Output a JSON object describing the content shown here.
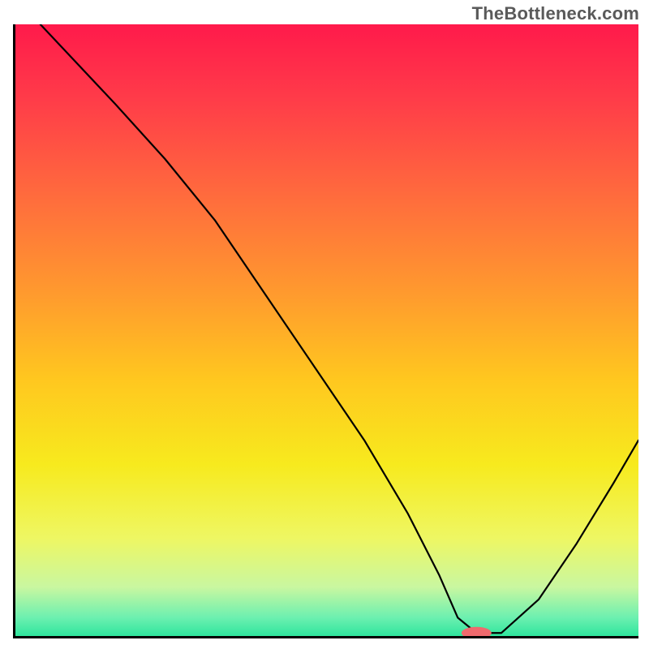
{
  "watermark": "TheBottleneck.com",
  "chart_data": {
    "type": "line",
    "title": "",
    "xlabel": "",
    "ylabel": "",
    "xlim": [
      0,
      100
    ],
    "ylim": [
      0,
      100
    ],
    "grid": false,
    "legend": false,
    "series": [
      {
        "name": "bottleneck-curve",
        "x": [
          4,
          16,
          24,
          32,
          40,
          48,
          56,
          63,
          68,
          71,
          74,
          78,
          84,
          90,
          96,
          100
        ],
        "y": [
          100,
          87,
          78,
          68,
          56,
          44,
          32,
          20,
          10,
          3,
          0.5,
          0.5,
          6,
          15,
          25,
          32
        ]
      }
    ],
    "marker": {
      "x": 74,
      "y": 0.5,
      "rx": 2.4,
      "ry": 1.0,
      "color": "#ef6a6e"
    },
    "background_gradient": {
      "stops": [
        {
          "offset": 0,
          "color": "#ff1a4b"
        },
        {
          "offset": 12,
          "color": "#ff3b49"
        },
        {
          "offset": 28,
          "color": "#ff6b3d"
        },
        {
          "offset": 44,
          "color": "#ff9a2e"
        },
        {
          "offset": 58,
          "color": "#ffc71f"
        },
        {
          "offset": 72,
          "color": "#f7ea1e"
        },
        {
          "offset": 84,
          "color": "#eef763"
        },
        {
          "offset": 92,
          "color": "#c9f7a0"
        },
        {
          "offset": 97,
          "color": "#6cf0b0"
        },
        {
          "offset": 100,
          "color": "#2fe59d"
        }
      ]
    }
  }
}
